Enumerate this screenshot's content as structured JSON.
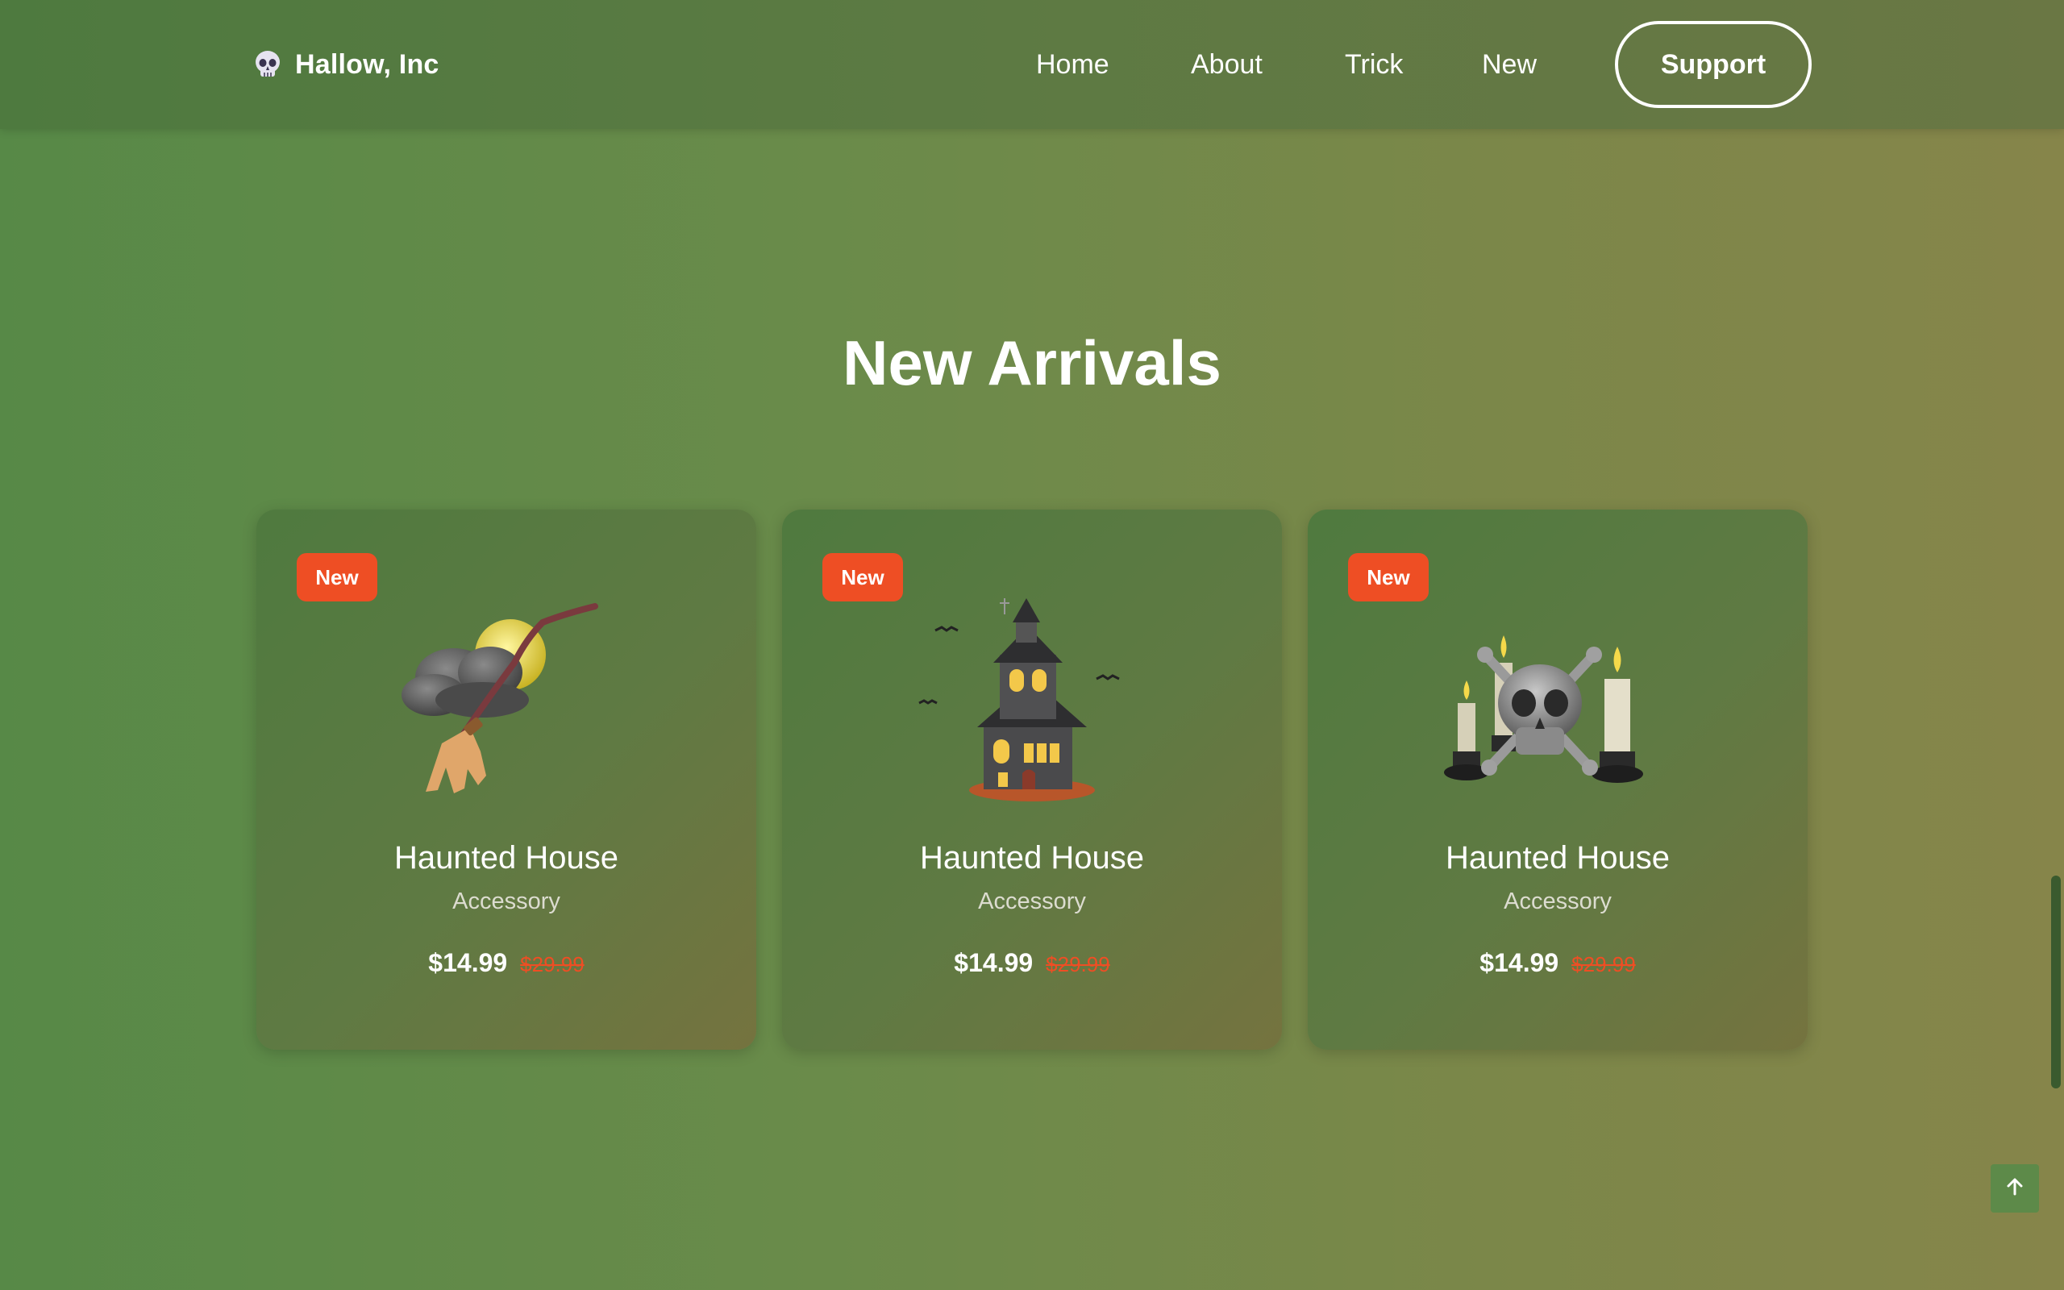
{
  "header": {
    "brand": "Hallow, Inc",
    "logo_icon": "skull-icon",
    "nav": [
      "Home",
      "About",
      "Trick",
      "New"
    ],
    "support_label": "Support"
  },
  "section": {
    "title": "New Arrivals"
  },
  "products": [
    {
      "badge": "New",
      "name": "Haunted House",
      "category": "Accessory",
      "price": "$14.99",
      "old_price": "$29.99",
      "art_icon": "broom-moon-cloud-icon"
    },
    {
      "badge": "New",
      "name": "Haunted House",
      "category": "Accessory",
      "price": "$14.99",
      "old_price": "$29.99",
      "art_icon": "haunted-house-icon"
    },
    {
      "badge": "New",
      "name": "Haunted House",
      "category": "Accessory",
      "price": "$14.99",
      "old_price": "$29.99",
      "art_icon": "skull-candles-icon"
    }
  ],
  "colors": {
    "accent": "#ee4e24",
    "background_start": "#578947",
    "background_end": "#86854a"
  },
  "back_to_top_icon": "arrow-up-icon"
}
